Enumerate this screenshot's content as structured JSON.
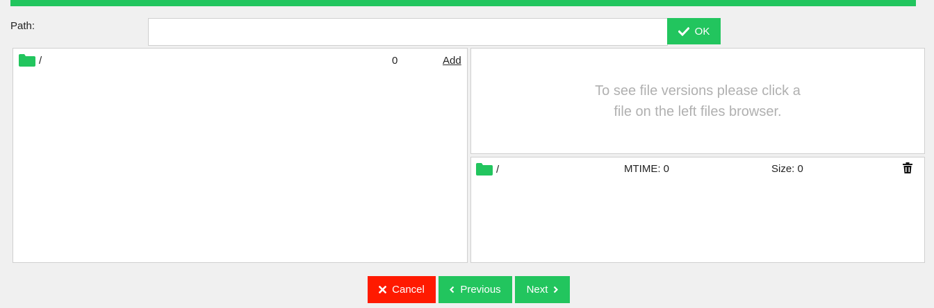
{
  "path": {
    "label": "Path:",
    "value": "",
    "ok_label": "OK"
  },
  "files": {
    "items": [
      {
        "name": "/",
        "count": "0",
        "action": "Add",
        "icon": "folder-icon"
      }
    ]
  },
  "versions": {
    "hint_line1": "To see file versions please click a",
    "hint_line2": "file on the left files browser.",
    "items": [
      {
        "name": "/",
        "mtime": "MTIME: 0",
        "size": "Size: 0",
        "icon": "folder-icon",
        "delete_icon": "trash-icon"
      }
    ]
  },
  "footer": {
    "cancel_label": "Cancel",
    "previous_label": "Previous",
    "next_label": "Next"
  },
  "colors": {
    "accent": "#22c55e",
    "danger": "#ff1a00",
    "hint": "#b0b0b0"
  }
}
